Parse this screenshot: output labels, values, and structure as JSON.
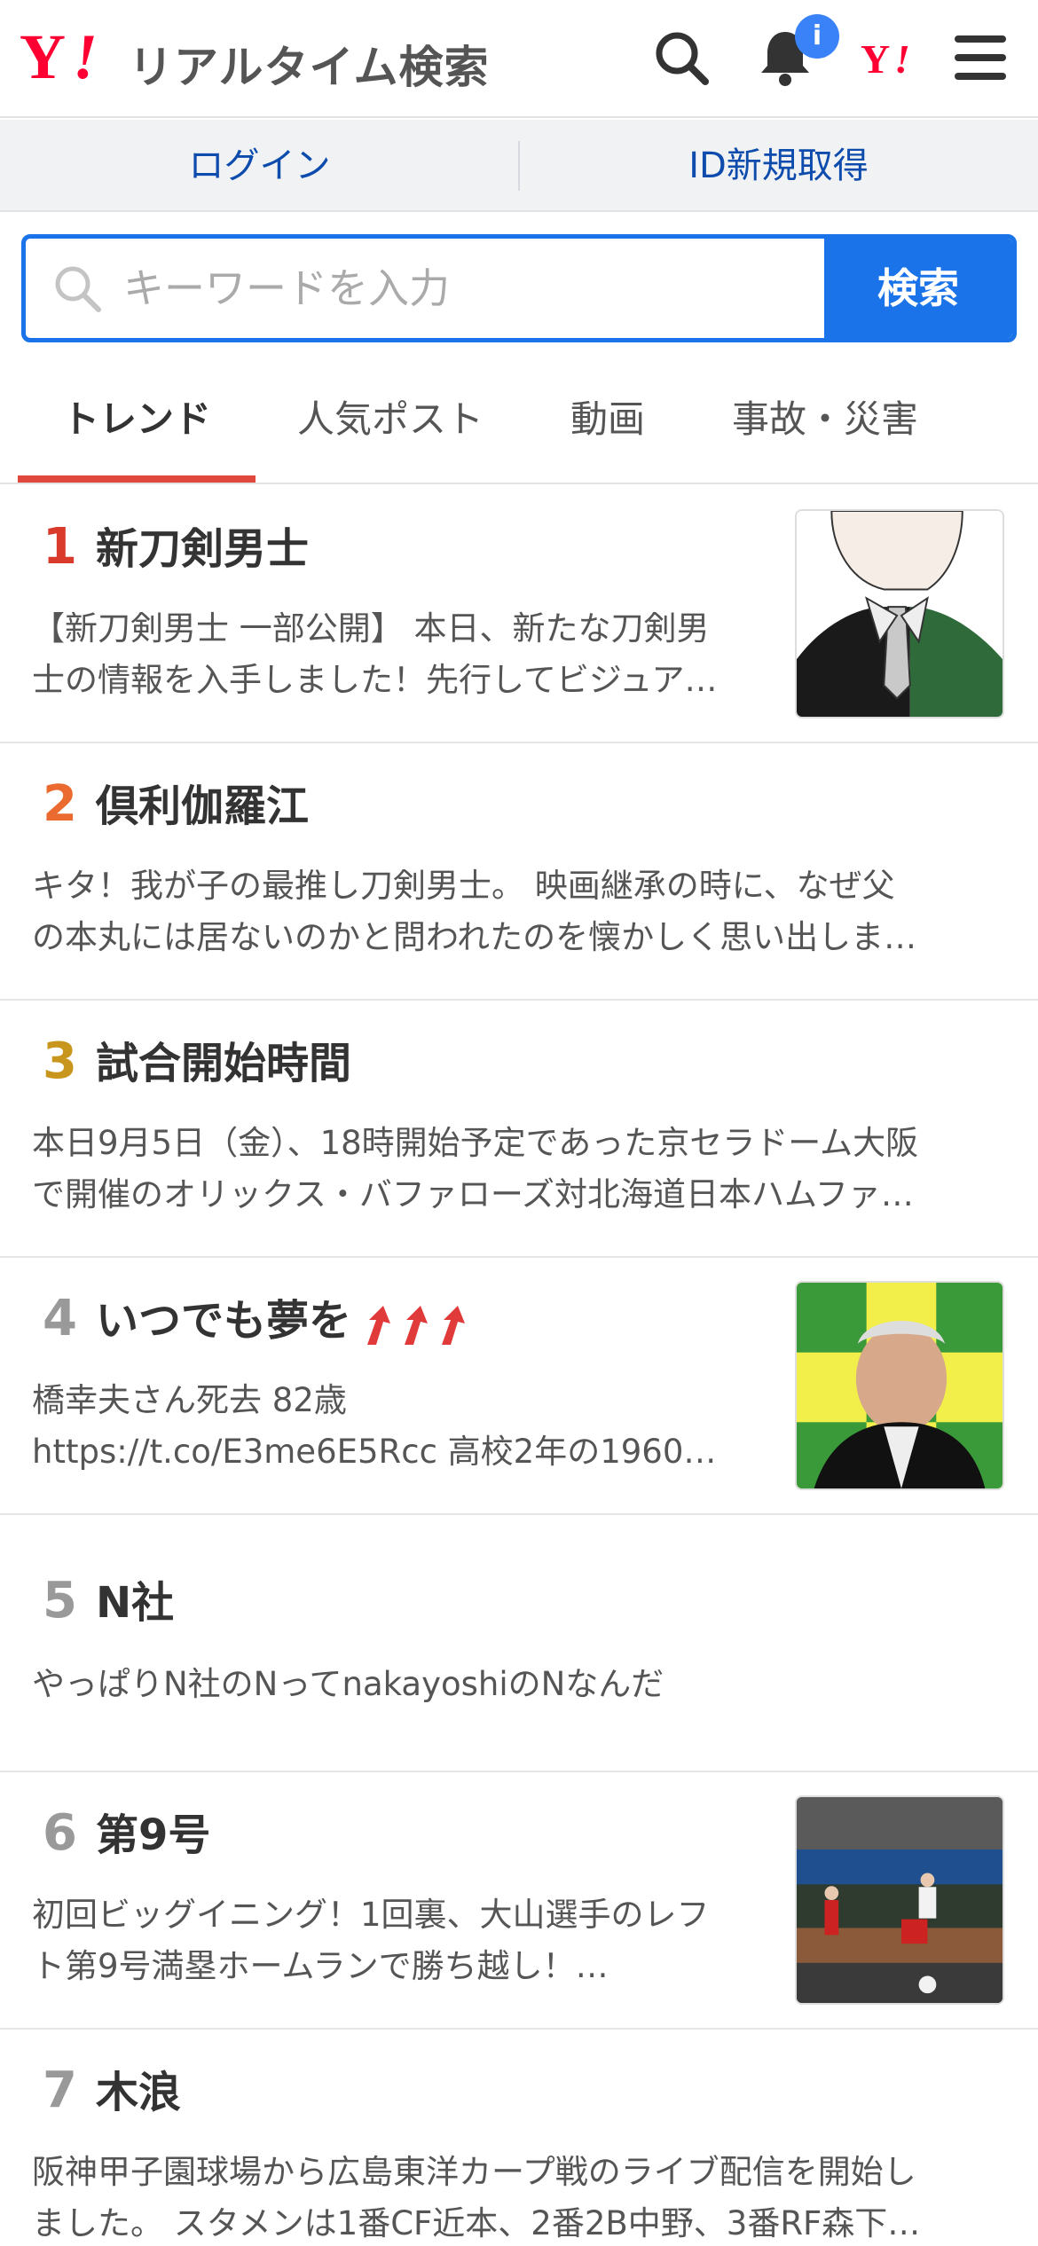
{
  "header": {
    "logo_mark": "Y!",
    "logo_text": "リアルタイム検索",
    "notification_badge": "i",
    "icons": [
      "search-icon",
      "bell-icon",
      "yahoo-japan-icon",
      "hamburger-menu-icon"
    ]
  },
  "auth": {
    "login": "ログイン",
    "register": "ID新規取得"
  },
  "search": {
    "placeholder": "キーワードを入力",
    "button": "検索"
  },
  "tabs": [
    {
      "label": "トレンド",
      "active": true
    },
    {
      "label": "人気ポスト",
      "active": false
    },
    {
      "label": "動画",
      "active": false
    },
    {
      "label": "事故・災害",
      "active": false
    }
  ],
  "colors": {
    "accent": "#1a73e8",
    "rank1": "#d93a2b",
    "rank2": "#ea6a2f",
    "rank3": "#c8961c",
    "rank_other": "#999999",
    "tab_underline": "#e0483e",
    "trend_up": "#e03a3a"
  },
  "trends": [
    {
      "rank": "1",
      "title": "新刀剣男士",
      "line1": "【新刀剣男士 一部公開】 本日、新たな刀剣男",
      "line2": "士の情報を入手しました！先行してビジュア…"
    },
    {
      "rank": "2",
      "title": "倶利伽羅江",
      "line1": "キタ！我が子の最推し刀剣男士。 映画継承の時に、なぜ父",
      "line2": "の本丸には居ないのかと問われたのを懐かしく思い出しま…"
    },
    {
      "rank": "3",
      "title": "試合開始時間",
      "line1": "本日9月5日（金）、18時開始予定であった京セラドーム大阪",
      "line2": "で開催のオリックス・バファローズ対北海道日本ハムファ…"
    },
    {
      "rank": "4",
      "title": "いつでも夢を",
      "line1": "橋幸夫さん死去 82歳",
      "line2": "https://t.co/E3me6E5Rcc 高校2年の1960…",
      "trending_up": true
    },
    {
      "rank": "5",
      "title": "N社",
      "line1": "やっぱりN社のNってnakayoshiのNなんだ",
      "line2": ""
    },
    {
      "rank": "6",
      "title": "第9号",
      "line1": "初回ビッグイニング！1回裏、大山選手のレフ",
      "line2": "ト第9号満塁ホームランで勝ち越し！…"
    },
    {
      "rank": "7",
      "title": "木浪",
      "line1": "阪神甲子園球場から広島東洋カープ戦のライブ配信を開始し",
      "line2": "ました。 スタメンは1番CF近本、2番2B中野、3番RF森下…"
    }
  ]
}
